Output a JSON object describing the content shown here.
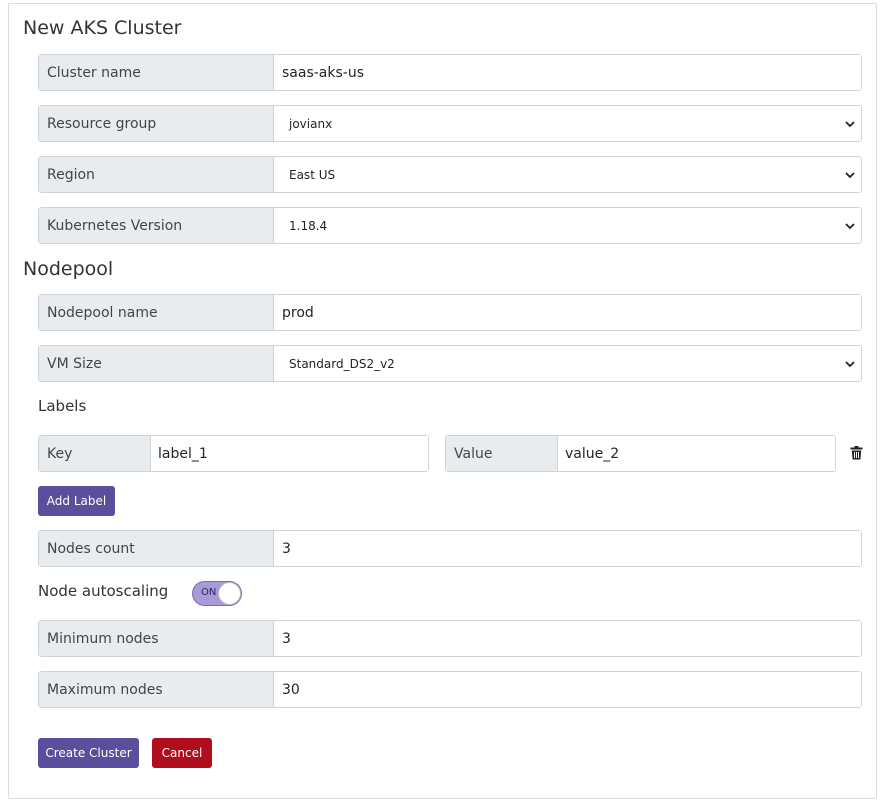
{
  "title": "New AKS Cluster",
  "cluster": {
    "name_label": "Cluster name",
    "name_value": "saas-aks-us",
    "resource_group_label": "Resource group",
    "resource_group_value": "jovianx",
    "region_label": "Region",
    "region_value": "East US",
    "k8s_label": "Kubernetes Version",
    "k8s_value": "1.18.4"
  },
  "nodepool": {
    "heading": "Nodepool",
    "name_label": "Nodepool name",
    "name_value": "prod",
    "vm_label": "VM Size",
    "vm_value": "Standard_DS2_v2",
    "labels_heading": "Labels",
    "labels": [
      {
        "key_label": "Key",
        "key_value": "label_1",
        "value_label": "Value",
        "value_value": "value_2"
      }
    ],
    "add_label_button": "Add Label",
    "nodes_count_label": "Nodes count",
    "nodes_count_value": "3",
    "autoscaling_label": "Node autoscaling",
    "autoscaling_state": "ON",
    "min_label": "Minimum nodes",
    "min_value": "3",
    "max_label": "Maximum nodes",
    "max_value": "30"
  },
  "actions": {
    "create": "Create Cluster",
    "cancel": "Cancel"
  },
  "icons": {
    "select_arrow": "chevron-down-icon",
    "delete": "trash-icon"
  },
  "colors": {
    "primary": "#5a4f9c",
    "danger": "#b00e1c",
    "toggle_on": "#a89ad8",
    "addon_bg": "#e9ecef"
  }
}
